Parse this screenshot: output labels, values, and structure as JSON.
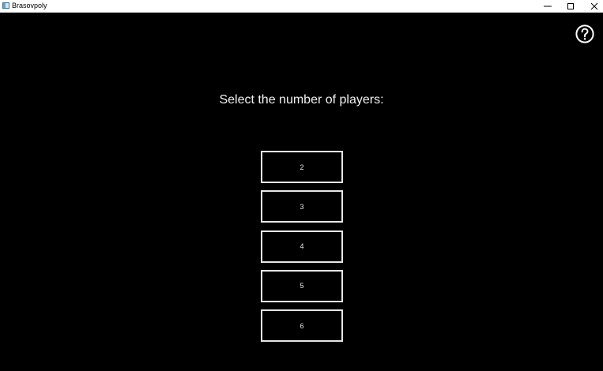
{
  "window": {
    "title": "Brasovpoly",
    "controls": {
      "minimize": "minimize-icon",
      "maximize": "maximize-icon",
      "close": "close-icon"
    }
  },
  "help": {
    "icon": "question-circle-icon"
  },
  "main": {
    "heading": "Select the number of players:",
    "player_options": [
      "2",
      "3",
      "4",
      "5",
      "6"
    ]
  },
  "colors": {
    "background": "#000000",
    "foreground": "#e6e6e6",
    "titlebar": "#ffffff"
  }
}
